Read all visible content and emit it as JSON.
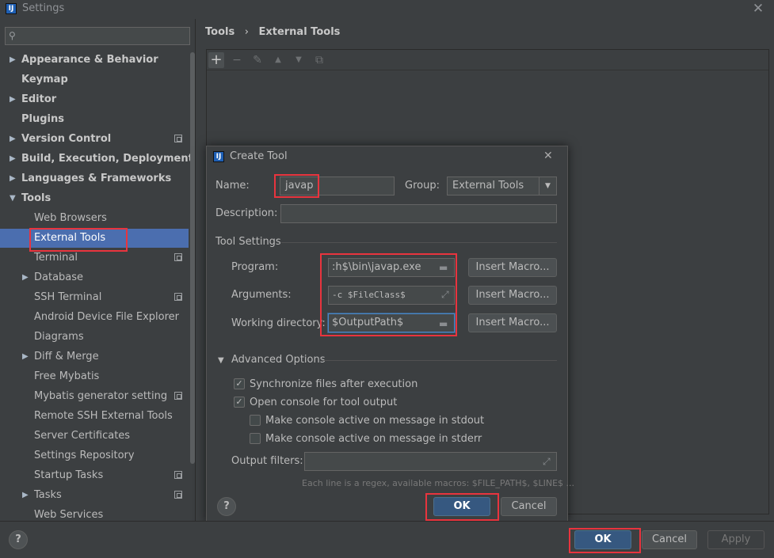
{
  "window": {
    "title": "Settings",
    "app_icon": "IJ",
    "close_glyph": "✕"
  },
  "search": {
    "placeholder": "",
    "icon": "search-icon"
  },
  "tree": [
    {
      "label": "Appearance & Behavior",
      "bold": true,
      "arrow": "▶",
      "indent": 0
    },
    {
      "label": "Keymap",
      "bold": true,
      "arrow": "",
      "indent": 0
    },
    {
      "label": "Editor",
      "bold": true,
      "arrow": "▶",
      "indent": 0
    },
    {
      "label": "Plugins",
      "bold": true,
      "arrow": "",
      "indent": 0
    },
    {
      "label": "Version Control",
      "bold": true,
      "arrow": "▶",
      "indent": 0,
      "proj": true
    },
    {
      "label": "Build, Execution, Deployment",
      "bold": true,
      "arrow": "▶",
      "indent": 0
    },
    {
      "label": "Languages & Frameworks",
      "bold": true,
      "arrow": "▶",
      "indent": 0
    },
    {
      "label": "Tools",
      "bold": true,
      "arrow": "▼",
      "indent": 0
    },
    {
      "label": "Web Browsers",
      "bold": false,
      "arrow": "",
      "indent": 1
    },
    {
      "label": "External Tools",
      "bold": false,
      "arrow": "",
      "indent": 1,
      "selected": true
    },
    {
      "label": "Terminal",
      "bold": false,
      "arrow": "",
      "indent": 1,
      "proj": true
    },
    {
      "label": "Database",
      "bold": false,
      "arrow": "▶",
      "indent": 1
    },
    {
      "label": "SSH Terminal",
      "bold": false,
      "arrow": "",
      "indent": 1,
      "proj": true
    },
    {
      "label": "Android Device File Explorer",
      "bold": false,
      "arrow": "",
      "indent": 1
    },
    {
      "label": "Diagrams",
      "bold": false,
      "arrow": "",
      "indent": 1
    },
    {
      "label": "Diff & Merge",
      "bold": false,
      "arrow": "▶",
      "indent": 1
    },
    {
      "label": "Free Mybatis",
      "bold": false,
      "arrow": "",
      "indent": 1
    },
    {
      "label": "Mybatis generator setting",
      "bold": false,
      "arrow": "",
      "indent": 1,
      "proj": true
    },
    {
      "label": "Remote SSH External Tools",
      "bold": false,
      "arrow": "",
      "indent": 1
    },
    {
      "label": "Server Certificates",
      "bold": false,
      "arrow": "",
      "indent": 1
    },
    {
      "label": "Settings Repository",
      "bold": false,
      "arrow": "",
      "indent": 1
    },
    {
      "label": "Startup Tasks",
      "bold": false,
      "arrow": "",
      "indent": 1,
      "proj": true
    },
    {
      "label": "Tasks",
      "bold": false,
      "arrow": "▶",
      "indent": 1,
      "proj": true
    },
    {
      "label": "Web Services",
      "bold": false,
      "arrow": "",
      "indent": 1
    }
  ],
  "breadcrumb": {
    "parent": "Tools",
    "separator": "›",
    "current": "External Tools"
  },
  "panel_toolbar": {
    "add": "+",
    "remove": "−",
    "edit": "✎",
    "up": "▲",
    "down": "▼",
    "copy": "⧉"
  },
  "dialog": {
    "title": "Create Tool",
    "close": "✕",
    "name_label": "Name:",
    "name_value": "javap",
    "group_label": "Group:",
    "group_value": "External Tools",
    "description_label": "Description:",
    "description_value": "",
    "tool_settings_label": "Tool Settings",
    "program_label": "Program:",
    "program_value": ":h$\\bin\\javap.exe",
    "arguments_label": "Arguments:",
    "arguments_value": "-c $FileClass$",
    "workdir_label": "Working directory:",
    "workdir_value": "$OutputPath$",
    "insert_macro": "Insert Macro...",
    "advanced_label": "Advanced Options",
    "sync_label": "Synchronize files after execution",
    "console_label": "Open console for tool output",
    "stdout_label": "Make console active on message in stdout",
    "stderr_label": "Make console active on message in stderr",
    "sync_checked": true,
    "console_checked": true,
    "stdout_checked": false,
    "stderr_checked": false,
    "output_filters_label": "Output filters:",
    "output_filters_value": "",
    "hint": "Each line is a regex, available macros: $FILE_PATH$, $LINE$ ...",
    "ok": "OK",
    "cancel": "Cancel",
    "help": "?"
  },
  "footer": {
    "help": "?",
    "ok": "OK",
    "cancel": "Cancel",
    "apply": "Apply"
  },
  "colors": {
    "highlight": "#e8343e",
    "selection": "#4b6eaf",
    "primary": "#365880"
  }
}
